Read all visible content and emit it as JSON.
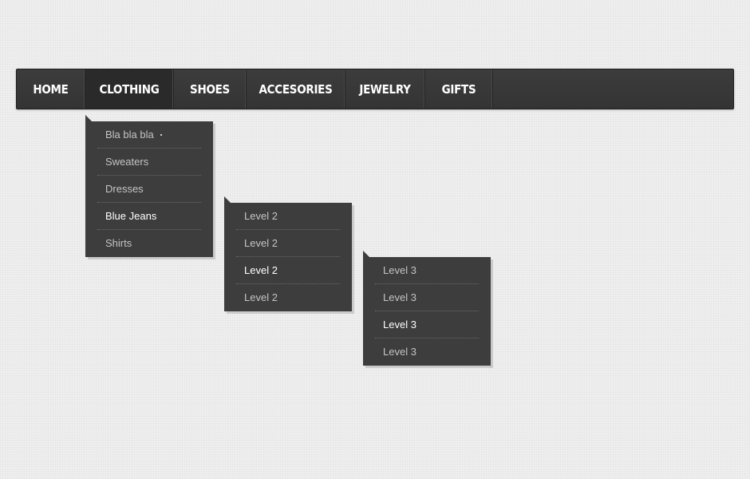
{
  "nav": {
    "items": [
      {
        "label": "HOME"
      },
      {
        "label": "CLOTHING"
      },
      {
        "label": "SHOES"
      },
      {
        "label": "ACCESORIES"
      },
      {
        "label": "JEWELRY"
      },
      {
        "label": "GIFTS"
      }
    ],
    "active": "CLOTHING"
  },
  "menus": {
    "clothing": [
      "Bla bla bla",
      "Sweaters",
      "Dresses",
      "Blue Jeans",
      "Shirts"
    ],
    "level2": [
      "Level 2",
      "Level 2",
      "Level 2",
      "Level 2"
    ],
    "level3": [
      "Level 3",
      "Level 3",
      "Level 3",
      "Level 3"
    ]
  },
  "colors": {
    "navbar": "#3a3a3a",
    "active_tab": "#2a2a2a",
    "dropdown": "#3d3d3d",
    "item_text": "#c4c4c4",
    "highlight_text": "#ffffff",
    "page_background": "#efefef"
  }
}
